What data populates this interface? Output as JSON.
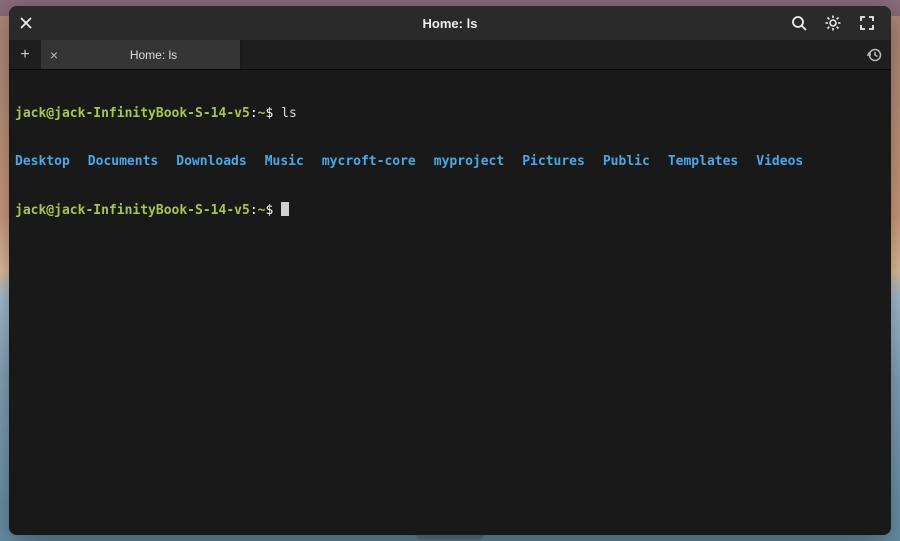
{
  "window": {
    "title": "Home: ls"
  },
  "tabs": [
    {
      "label": "Home: ls"
    }
  ],
  "toolbar": {
    "newtab_symbol": "+",
    "close_symbol": "×"
  },
  "terminal": {
    "prompt_user_host": "jack@jack-InfinityBook-S-14-v5",
    "prompt_path": "~",
    "prompt_sep1": ":",
    "prompt_sep2": "$",
    "lines": [
      {
        "cmd": "ls"
      }
    ],
    "ls_output": [
      "Desktop",
      "Documents",
      "Downloads",
      "Music",
      "mycroft-core",
      "myproject",
      "Pictures",
      "Public",
      "Templates",
      "Videos"
    ]
  }
}
